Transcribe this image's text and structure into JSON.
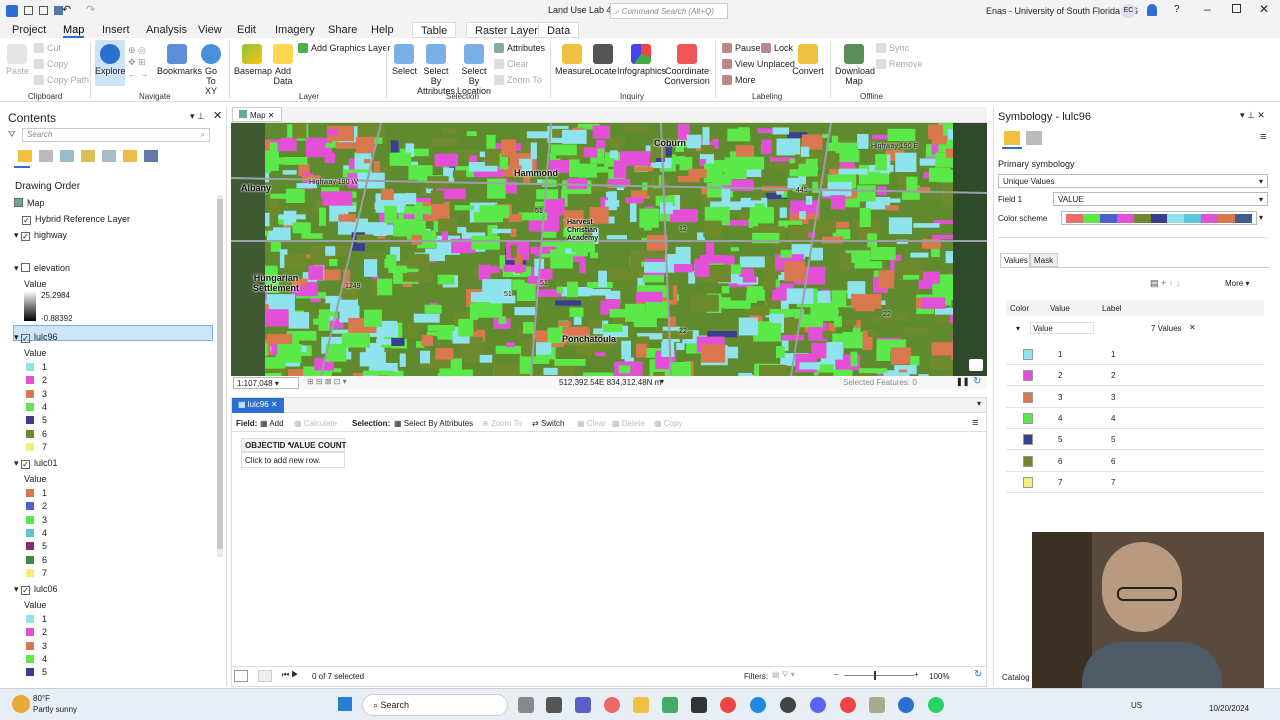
{
  "titlebar": {
    "title": "Land Use Lab 4",
    "search_placeholder": "Command Search (Alt+Q)",
    "user": "Enas - University of South Florida GIS",
    "user_initials": "EC",
    "help": "?"
  },
  "ribbon_tabs": [
    "Project",
    "Map",
    "Insert",
    "Analysis",
    "View",
    "Edit",
    "Imagery",
    "Share",
    "Help",
    "Table",
    "Raster Layer",
    "Data"
  ],
  "ribbon": {
    "clipboard": {
      "paste": "Paste",
      "cut": "Cut",
      "copy": "Copy",
      "copy_path": "Copy Path",
      "group": "Clipboard"
    },
    "navigate": {
      "explore": "Explore",
      "bookmarks": "Bookmarks",
      "goto": "Go To XY",
      "group": "Navigate"
    },
    "layer": {
      "basemap": "Basemap",
      "add_data": "Add Data",
      "add_graphics": "Add Graphics Layer",
      "group": "Layer"
    },
    "selection": {
      "select": "Select",
      "select_by_attr": "Select By Attributes",
      "select_by_loc": "Select By Location",
      "attributes": "Attributes",
      "clear": "Clear",
      "zoom_to": "Zoom To",
      "group": "Selection"
    },
    "inquiry": {
      "measure": "Measure",
      "locate": "Locate",
      "infographics": "Infographics",
      "coord_conv": "Coordinate Conversion",
      "group": "Inquiry"
    },
    "labeling": {
      "pause": "Pause",
      "lock": "Lock",
      "view_unplaced": "View Unplaced",
      "more": "More",
      "convert": "Convert",
      "group": "Labeling"
    },
    "offline": {
      "download": "Download Map",
      "sync": "Sync",
      "remove": "Remove",
      "group": "Offline"
    }
  },
  "contents": {
    "title": "Contents",
    "search_placeholder": "Search",
    "drawing_order": "Drawing Order",
    "map": "Map",
    "hybrid": "Hybrid Reference Layer",
    "highway": "highway",
    "elevation": "elevation",
    "value": "Value",
    "elev_high": "25.2984",
    "elev_low": "-0.88392",
    "layers": [
      {
        "name": "lulc96",
        "items": [
          {
            "v": "1",
            "c": "#8fe3ec"
          },
          {
            "v": "2",
            "c": "#e44fd8"
          },
          {
            "v": "3",
            "c": "#d9784f"
          },
          {
            "v": "4",
            "c": "#5be94a"
          },
          {
            "v": "5",
            "c": "#3d3d8f"
          },
          {
            "v": "6",
            "c": "#6f8a2d"
          },
          {
            "v": "7",
            "c": "#f1f17a"
          }
        ]
      },
      {
        "name": "lulc01",
        "items": [
          {
            "v": "1",
            "c": "#d9784f"
          },
          {
            "v": "2",
            "c": "#4f5fd0"
          },
          {
            "v": "3",
            "c": "#5be94a"
          },
          {
            "v": "4",
            "c": "#5fc5d8"
          },
          {
            "v": "5",
            "c": "#8a2d6a"
          },
          {
            "v": "6",
            "c": "#3f8a4a"
          },
          {
            "v": "7",
            "c": "#f1f17a"
          }
        ]
      },
      {
        "name": "lulc06",
        "items": [
          {
            "v": "1",
            "c": "#8fe3ec"
          },
          {
            "v": "2",
            "c": "#e44fd8"
          },
          {
            "v": "3",
            "c": "#d9784f"
          },
          {
            "v": "4",
            "c": "#5be94a"
          },
          {
            "v": "5",
            "c": "#3d3d8f"
          }
        ]
      }
    ]
  },
  "map": {
    "tab": "Map",
    "scale": "1:107,048",
    "coords": "512,392.54E 834,312.48N m",
    "selected": "Selected Features: 0",
    "labels": {
      "albany": "Albany",
      "hammond": "Hammond",
      "coburn": "Coburn",
      "hungarian": "Hungarian Settlement",
      "ponchatoula": "Ponchatoula",
      "harvest": "Harvest Christian Academy",
      "hwy190w": "Highway 190 W",
      "hwy190e": "Highway 190 E",
      "r51a": "51",
      "r51b": "51",
      "r51c": "51",
      "r445": "445",
      "r1249": "1249",
      "r22a": "22",
      "r22b": "22",
      "r12": "12"
    }
  },
  "table": {
    "tab": "lulc96",
    "field": "Field:",
    "add": "Add",
    "calculate": "Calculate",
    "selection": "Selection:",
    "select_by_attr": "Select By Attributes",
    "zoom_to": "Zoom To",
    "switch": "Switch",
    "clear": "Clear",
    "delete": "Delete",
    "copy": "Copy",
    "headers": [
      "OBJECTID *",
      "VALUE",
      "COUNT"
    ],
    "add_row": "Click to add new row.",
    "status": "0 of 7 selected",
    "filters": "Filters:",
    "zoom": "100%"
  },
  "symbology": {
    "title": "Symbology - lulc96",
    "primary": "Primary symbology",
    "method": "Unique Values",
    "field1_label": "Field 1",
    "field1": "VALUE",
    "scheme_label": "Color scheme",
    "scheme": [
      "#e86d6d",
      "#5be94a",
      "#4f5fd0",
      "#e44fd8",
      "#6f8a2d",
      "#3d3d8f",
      "#8fe3ec",
      "#5fc5d8",
      "#e44fd8",
      "#d9784f",
      "#3d5f8f"
    ],
    "tabs": [
      "Values",
      "Mask"
    ],
    "more": "More",
    "col_color": "Color",
    "col_value": "Value",
    "col_label": "Label",
    "group_field": "Value",
    "count": "7 Values",
    "rows": [
      {
        "v": "1",
        "l": "1",
        "c": "#8fe3ec"
      },
      {
        "v": "2",
        "l": "2",
        "c": "#e44fd8"
      },
      {
        "v": "3",
        "l": "3",
        "c": "#d9784f"
      },
      {
        "v": "4",
        "l": "4",
        "c": "#5be94a"
      },
      {
        "v": "5",
        "l": "5",
        "c": "#3d3d8f"
      },
      {
        "v": "6",
        "l": "6",
        "c": "#6f8a2d"
      },
      {
        "v": "7",
        "l": "7",
        "c": "#f1f17a"
      }
    ],
    "catalog": "Catalog"
  },
  "taskbar": {
    "temp": "80°F",
    "weather": "Partly sunny",
    "search": "Search",
    "lang": "US",
    "date": "10/20/2024"
  }
}
